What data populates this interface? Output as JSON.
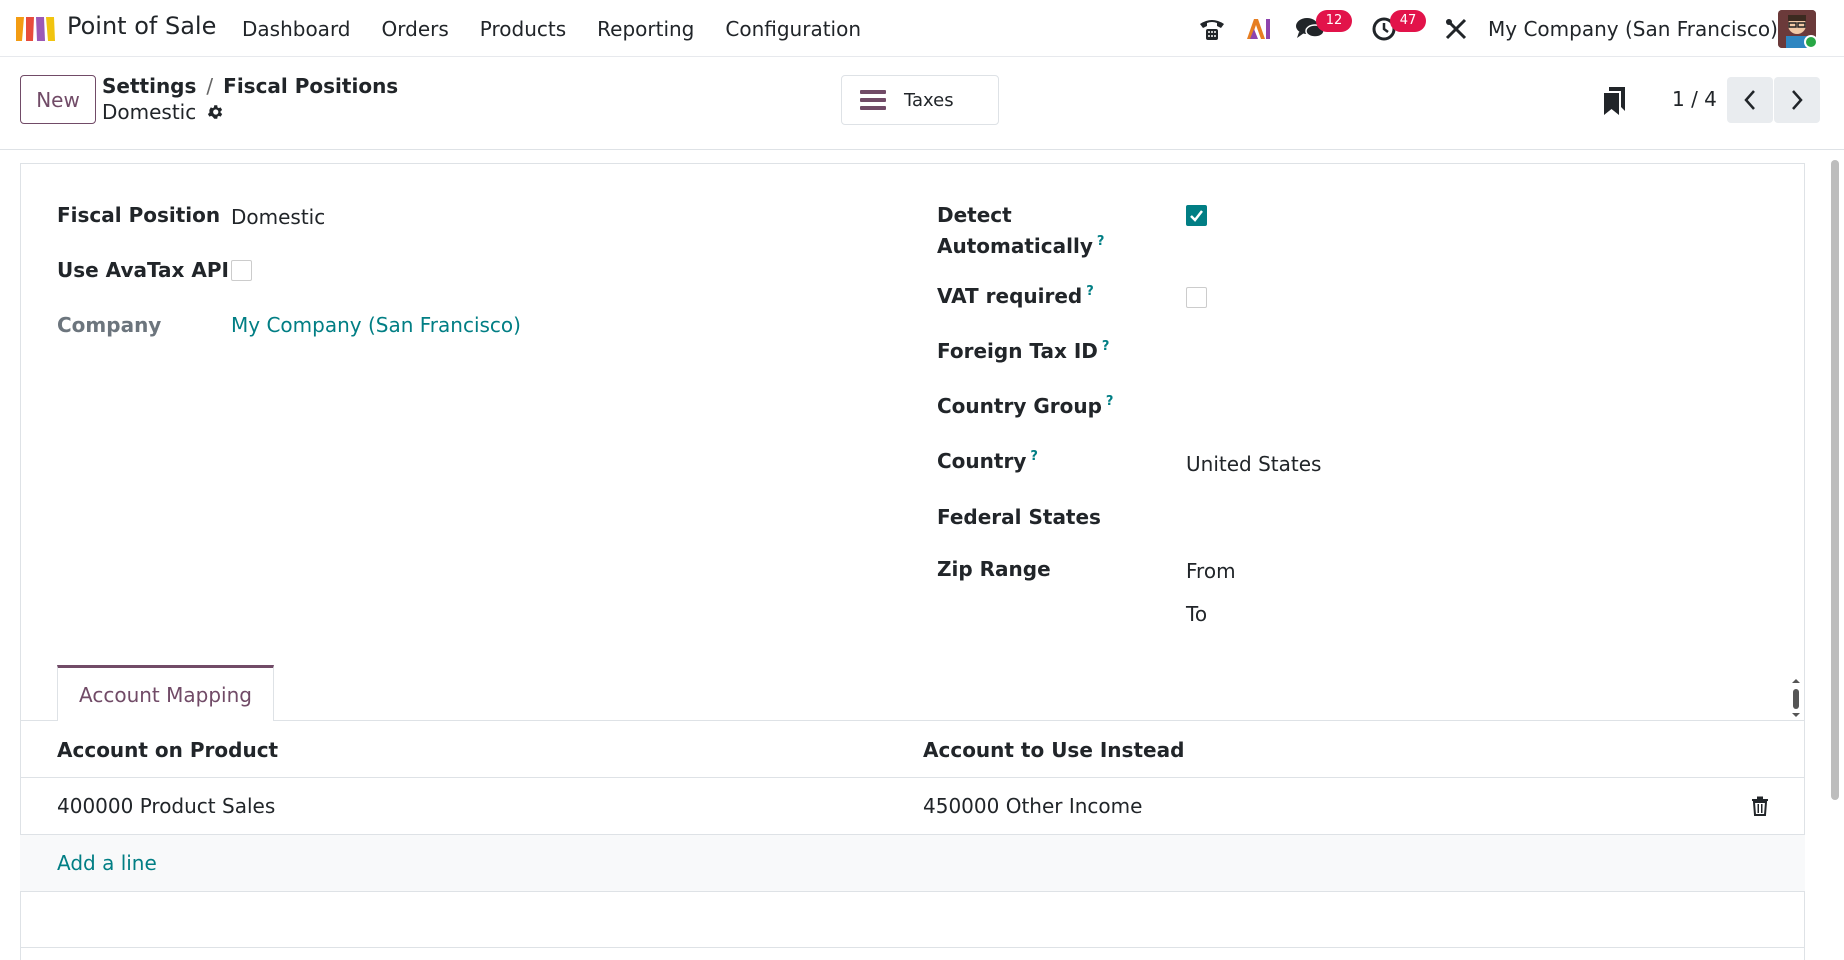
{
  "navbar": {
    "app_name": "Point of Sale",
    "menu": [
      "Dashboard",
      "Orders",
      "Products",
      "Reporting",
      "Configuration"
    ],
    "messages_count": "12",
    "activities_count": "47",
    "company": "My Company (San Francisco)"
  },
  "control_panel": {
    "new_label": "New",
    "breadcrumb": [
      "Settings",
      "Fiscal Positions"
    ],
    "record_name": "Domestic",
    "taxes_button": "Taxes",
    "pager": "1 / 4"
  },
  "form": {
    "fiscal_position_label": "Fiscal Position",
    "fiscal_position_value": "Domestic",
    "use_avatax_label": "Use AvaTax API",
    "use_avatax_checked": false,
    "company_label": "Company",
    "company_value": "My Company (San Francisco)",
    "detect_label_line1": "Detect",
    "detect_label_line2": "Automatically",
    "detect_checked": true,
    "vat_required_label": "VAT required",
    "vat_required_checked": false,
    "foreign_tax_label": "Foreign Tax ID",
    "country_group_label": "Country Group",
    "country_label": "Country",
    "country_value": "United States",
    "federal_states_label": "Federal States",
    "zip_range_label": "Zip Range",
    "zip_from_label": "From",
    "zip_to_label": "To",
    "help_mark": "?"
  },
  "tabs": {
    "active": "Account Mapping"
  },
  "account_table": {
    "columns": [
      "Account on Product",
      "Account to Use Instead"
    ],
    "rows": [
      [
        "400000 Product Sales",
        "450000 Other Income"
      ]
    ],
    "add_line": "Add a line"
  },
  "colors": {
    "brand": "#714b67",
    "link": "#017e84",
    "badge": "#e2134a"
  }
}
